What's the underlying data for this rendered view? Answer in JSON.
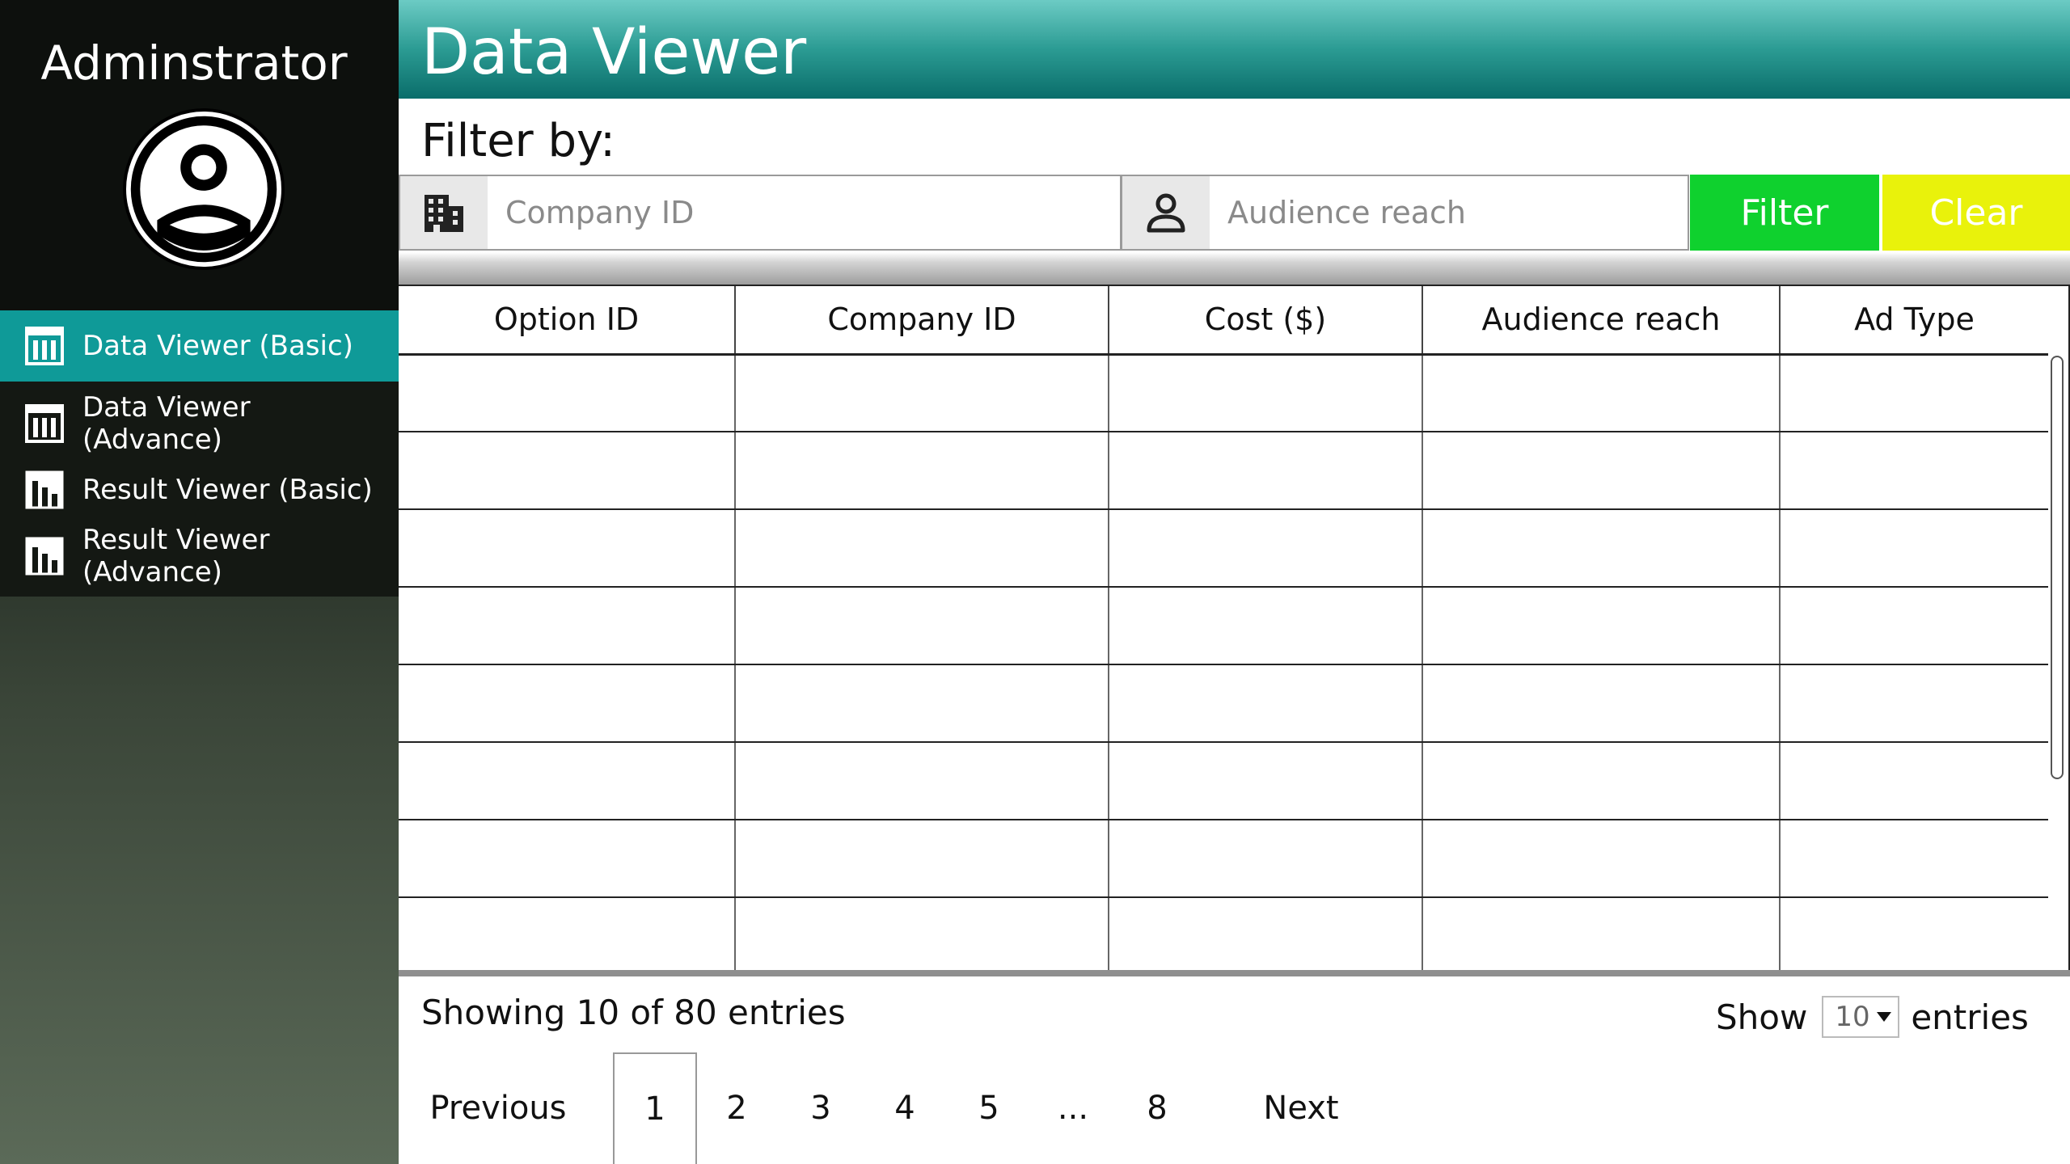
{
  "sidebar": {
    "title": "Adminstrator",
    "items": [
      {
        "label": "Data Viewer (Basic)",
        "icon": "table-icon",
        "active": true
      },
      {
        "label": "Data Viewer (Advance)",
        "icon": "table-icon",
        "active": false
      },
      {
        "label": "Result Viewer (Basic)",
        "icon": "bar-chart-icon",
        "active": false
      },
      {
        "label": "Result Viewer (Advance)",
        "icon": "bar-chart-icon",
        "active": false
      }
    ]
  },
  "header": {
    "title": "Data Viewer"
  },
  "filter": {
    "label": "Filter by:",
    "company_placeholder": "Company ID",
    "audience_placeholder": "Audience reach",
    "filter_button": "Filter",
    "clear_button": "Clear"
  },
  "table": {
    "columns": [
      "Option ID",
      "Company ID",
      "Cost ($)",
      "Audience reach",
      "Ad Type"
    ]
  },
  "footer": {
    "showing": "Showing 10 of 80 entries",
    "show_label": "Show",
    "show_value": "10",
    "entries_label": "entries",
    "pagination": {
      "previous": "Previous",
      "pages": [
        "1",
        "2",
        "3",
        "4",
        "5",
        "...",
        "8"
      ],
      "next": "Next",
      "current": "1"
    }
  },
  "colors": {
    "active_nav": "#0f9a98",
    "filter_button": "#0fd12e",
    "clear_button": "#e9f20b",
    "header": "#2b9b93"
  }
}
